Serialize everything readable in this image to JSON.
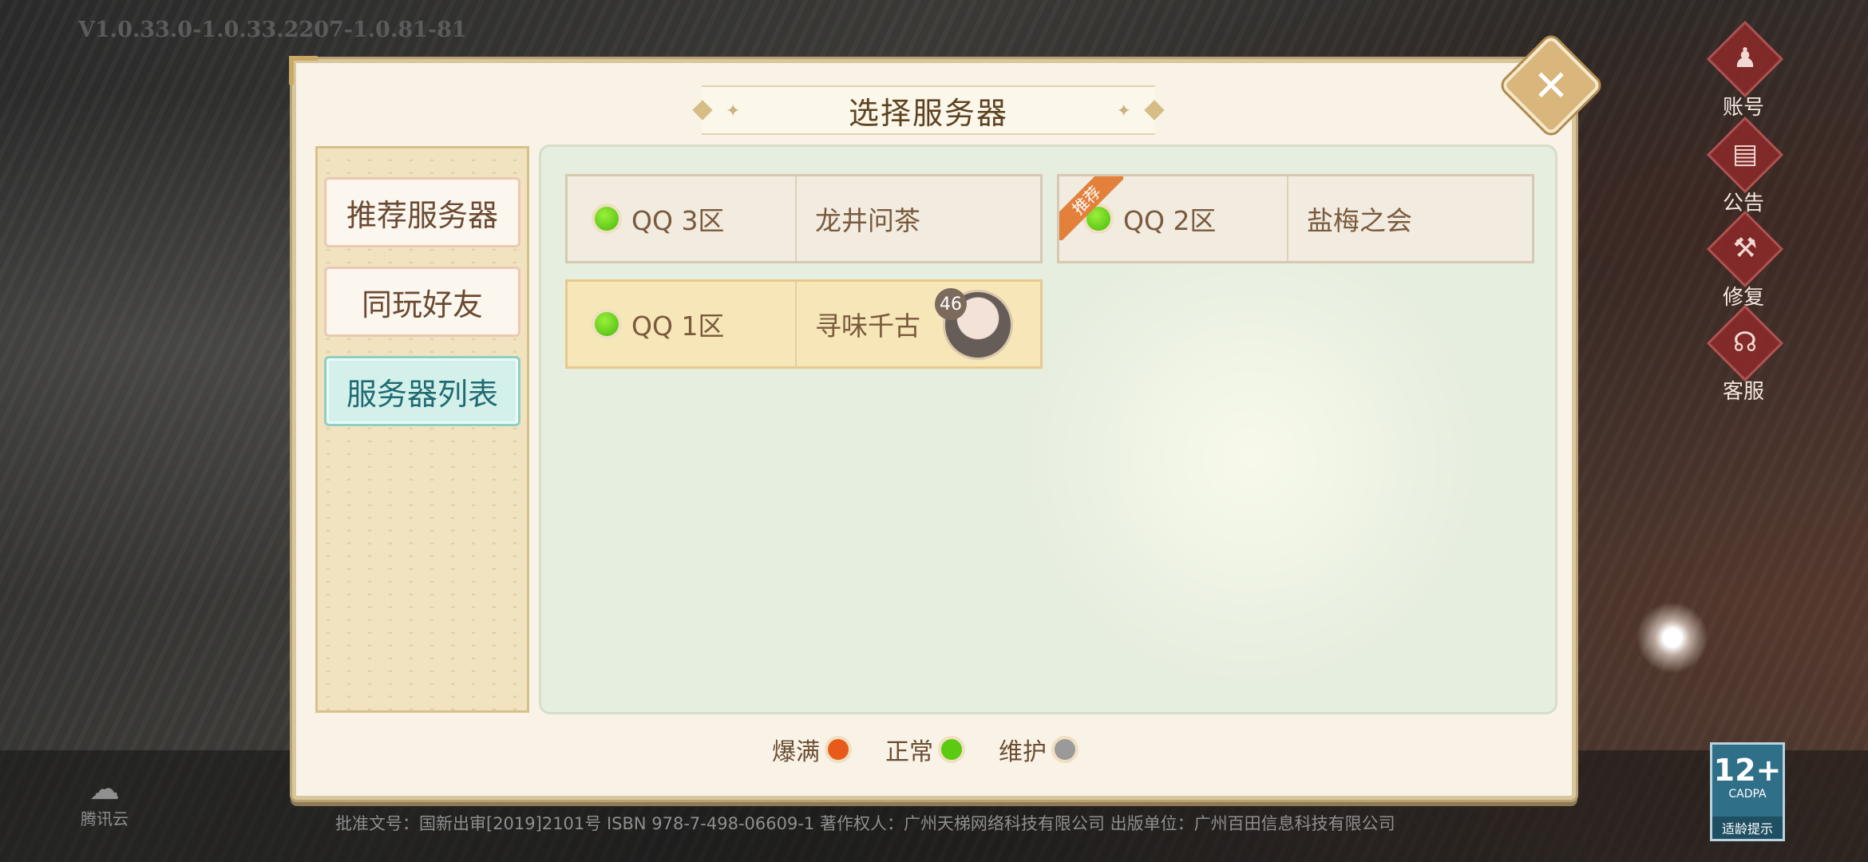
{
  "version": "V1.0.33.0-1.0.33.2207-1.0.81-81",
  "dialog": {
    "title": "选择服务器",
    "close_symbol": "✕"
  },
  "sidebar": {
    "items": [
      {
        "label": "推荐服务器",
        "active": false
      },
      {
        "label": "同玩好友",
        "active": false
      },
      {
        "label": "服务器列表",
        "active": true
      }
    ]
  },
  "servers": [
    {
      "zone": "QQ  3区",
      "name": "龙井问茶",
      "status": "normal",
      "recommended": false
    },
    {
      "zone": "QQ  2区",
      "name": "盐梅之会",
      "status": "normal",
      "recommended": true,
      "badge": "推荐"
    },
    {
      "zone": "QQ  1区",
      "name": "寻味千古",
      "status": "normal",
      "recommended": false,
      "avatar_level": "46"
    }
  ],
  "legend": [
    {
      "label": "爆满",
      "color": "#e85a1a"
    },
    {
      "label": "正常",
      "color": "#5acb10"
    },
    {
      "label": "维护",
      "color": "#9a9a9a"
    }
  ],
  "right_menu": [
    {
      "label": "账号",
      "icon": "account-icon"
    },
    {
      "label": "公告",
      "icon": "announcement-icon"
    },
    {
      "label": "修复",
      "icon": "repair-icon"
    },
    {
      "label": "客服",
      "icon": "customer-service-icon"
    }
  ],
  "tencent_cloud": "腾讯云",
  "footer": "批准文号：国新出审[2019]2101号  ISBN  978-7-498-06609-1   著作权人：广州天梯网络科技有限公司   出版单位：广州百田信息科技有限公司",
  "age_rating": {
    "value": "12+",
    "org": "CADPA",
    "tip": "适龄提示"
  }
}
